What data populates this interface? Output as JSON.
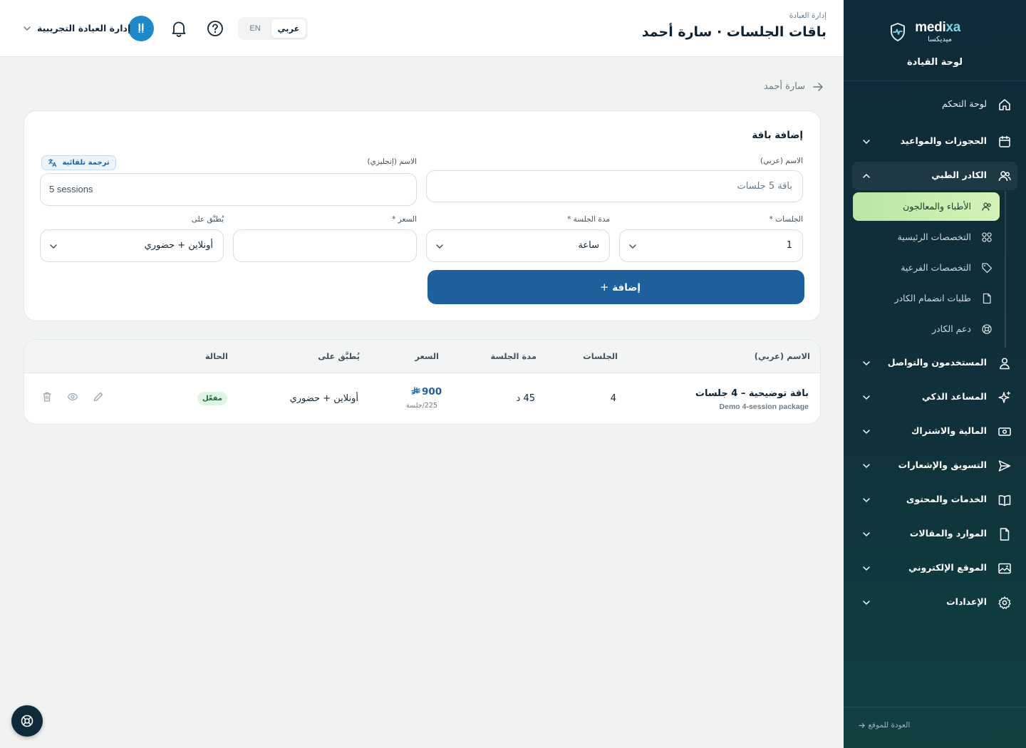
{
  "header": {
    "breadcrumb": "إدارة العيادة",
    "title": "باقات الجلسات · سارة أحمد",
    "lang_ar": "عربي",
    "lang_en": "EN",
    "user_initials": "إإ",
    "user_name": "إدارة العيادة التجريبية"
  },
  "sidebar": {
    "brand_en_1": "medi",
    "brand_en_2": "xa",
    "brand_ar": "ميديكسا",
    "panel_title": "لوحة القيادة",
    "items": [
      {
        "label": "لوحة التحكم",
        "icon": "home-icon"
      },
      {
        "label": "الحجوزات والمواعيد",
        "icon": "calendar-icon"
      },
      {
        "label": "الكادر الطبي",
        "icon": "users-icon"
      },
      {
        "label": "المستخدمون والتواصل",
        "icon": "user-icon"
      },
      {
        "label": "المساعد الذكي",
        "icon": "sparkles-icon"
      },
      {
        "label": "المالية والاشتراك",
        "icon": "money-icon"
      },
      {
        "label": "التسويق والإشعارات",
        "icon": "send-icon"
      },
      {
        "label": "الخدمات والمحتوى",
        "icon": "book-icon"
      },
      {
        "label": "الموارد والمقالات",
        "icon": "file-icon"
      },
      {
        "label": "الموقع الإلكتروني",
        "icon": "image-icon"
      },
      {
        "label": "الإعدادات",
        "icon": "gear-icon"
      }
    ],
    "subitems": [
      {
        "label": "الأطباء والمعالجون",
        "icon": "users-icon"
      },
      {
        "label": "التخصصات الرئيسية",
        "icon": "grid-icon"
      },
      {
        "label": "التخصصات الفرعية",
        "icon": "tag-icon"
      },
      {
        "label": "طلبات انضمام الكادر",
        "icon": "file-icon"
      },
      {
        "label": "دعم الكادر",
        "icon": "lifebuoy-icon"
      }
    ],
    "back_to_site": "العودة للموقع"
  },
  "page": {
    "back_label": "سارة أحمد"
  },
  "form": {
    "title": "إضافة باقة",
    "name_ar_label": "الاسم (عربي)",
    "name_ar_placeholder": "باقة 5 جلسات",
    "name_en_label": "الاسم (إنجليزي)",
    "name_en_placeholder": "5 sessions",
    "auto_translate": "ترجمة تلقائية",
    "sessions_label": "الجلسات *",
    "sessions_value": "1",
    "duration_label": "مدة الجلسة *",
    "duration_value": "ساعة",
    "price_label": "السعر *",
    "price_value": "",
    "applies_label": "يُطبَّق على",
    "applies_value": "أونلاين + حضوري",
    "add_button": "إضافة"
  },
  "table": {
    "columns": [
      "الاسم (عربي)",
      "الجلسات",
      "مدة الجلسة",
      "السعر",
      "يُطبَّق على",
      "الحالة"
    ],
    "rows": [
      {
        "name_ar": "باقة توضيحية – 4 جلسات",
        "name_en": "Demo 4-session package",
        "sessions": "4",
        "duration": "45 د",
        "price": "900",
        "per_session": "225/جلسة",
        "applies": "أونلاين + حضوري",
        "status": "مفعّل"
      }
    ]
  },
  "colors": {
    "primary": "#1e5f9e",
    "sidebar_bg": "#0f2a38",
    "active_item": "#c4ebab",
    "status_bg": "#def5e5"
  }
}
